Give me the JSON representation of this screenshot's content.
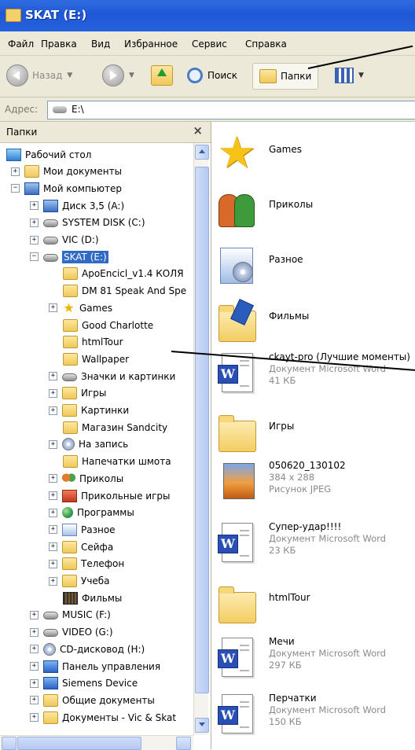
{
  "window": {
    "title": "SKAT (E:)"
  },
  "menu": [
    "Файл",
    "Правка",
    "Вид",
    "Избранное",
    "Сервис",
    "Справка"
  ],
  "toolbar": {
    "back": "Назад",
    "search": "Поиск",
    "folders": "Папки"
  },
  "address": {
    "label": "Адрес:",
    "value": "E:\\"
  },
  "folders_pane": {
    "title": "Папки",
    "close": "×",
    "tree": [
      {
        "label": "Рабочий стол",
        "icon": "desktop-icon"
      },
      {
        "label": "Мои документы",
        "icon": "folder-icon"
      },
      {
        "label": "Мой компьютер",
        "icon": "computer-icon"
      },
      {
        "label": "Диск 3,5 (A:)",
        "icon": "floppy-icon"
      },
      {
        "label": "SYSTEM DISK (C:)",
        "icon": "drive-icon"
      },
      {
        "label": "VIC (D:)",
        "icon": "drive-icon"
      },
      {
        "label": "SKAT (E:)",
        "icon": "drive-icon"
      },
      {
        "label": "ApoEncicl_v1.4 КОЛЯ",
        "icon": "folder-icon"
      },
      {
        "label": "DM 81 Speak And Spe",
        "icon": "folder-icon"
      },
      {
        "label": "Games",
        "icon": "star-icon"
      },
      {
        "label": "Good Charlotte",
        "icon": "folder-icon"
      },
      {
        "label": "htmlTour",
        "icon": "folder-icon"
      },
      {
        "label": "Wallpaper",
        "icon": "folder-icon"
      },
      {
        "label": "Значки и картинки",
        "icon": "drive-icon"
      },
      {
        "label": "Игры",
        "icon": "folder-icon"
      },
      {
        "label": "Картинки",
        "icon": "folder-icon"
      },
      {
        "label": "Магазин Sandcity",
        "icon": "folder-icon"
      },
      {
        "label": "На запись",
        "icon": "cd-icon"
      },
      {
        "label": "Напечатки шмота",
        "icon": "folder-icon"
      },
      {
        "label": "Приколы",
        "icon": "people-icon"
      },
      {
        "label": "Прикольные игры",
        "icon": "book-icon"
      },
      {
        "label": "Программы",
        "icon": "globe-icon"
      },
      {
        "label": "Разное",
        "icon": "box-icon"
      },
      {
        "label": "Сейфа",
        "icon": "folder-icon"
      },
      {
        "label": "Телефон",
        "icon": "folder-icon"
      },
      {
        "label": "Учеба",
        "icon": "folder-icon"
      },
      {
        "label": "Фильмы",
        "icon": "film-icon"
      },
      {
        "label": "MUSIC (F:)",
        "icon": "drive-icon"
      },
      {
        "label": "VIDEO (G:)",
        "icon": "drive-icon"
      },
      {
        "label": "CD-дисковод (H:)",
        "icon": "cd-icon"
      },
      {
        "label": "Панель управления",
        "icon": "control-panel-icon"
      },
      {
        "label": "Siemens Device",
        "icon": "phone-icon"
      },
      {
        "label": "Общие документы",
        "icon": "folder-icon"
      },
      {
        "label": "Документы - Vic & Skat",
        "icon": "folder-icon"
      }
    ]
  },
  "files": [
    {
      "name": "Games",
      "icon": "star-icon"
    },
    {
      "name": "Приколы",
      "icon": "people-icon"
    },
    {
      "name": "Разное",
      "icon": "box-icon"
    },
    {
      "name": "Фильмы",
      "icon": "film-folder-icon"
    },
    {
      "name": "ckayt-pro (Лучшие моменты)",
      "type": "Документ Microsoft Word",
      "size": "41 КБ",
      "icon": "word-doc-icon"
    },
    {
      "name": "Игры",
      "icon": "folder-icon"
    },
    {
      "name": "050620_130102",
      "type": "384 x 288",
      "size": "Рисунок JPEG",
      "icon": "image-icon"
    },
    {
      "name": "Супер-удар!!!!",
      "type": "Документ Microsoft Word",
      "size": "23 КБ",
      "icon": "word-doc-icon"
    },
    {
      "name": "htmlTour",
      "icon": "folder-icon"
    },
    {
      "name": "Мечи",
      "type": "Документ Microsoft Word",
      "size": "297 КБ",
      "icon": "word-doc-icon"
    },
    {
      "name": "Перчатки",
      "type": "Документ Microsoft Word",
      "size": "150 КБ",
      "icon": "word-doc-icon"
    }
  ]
}
